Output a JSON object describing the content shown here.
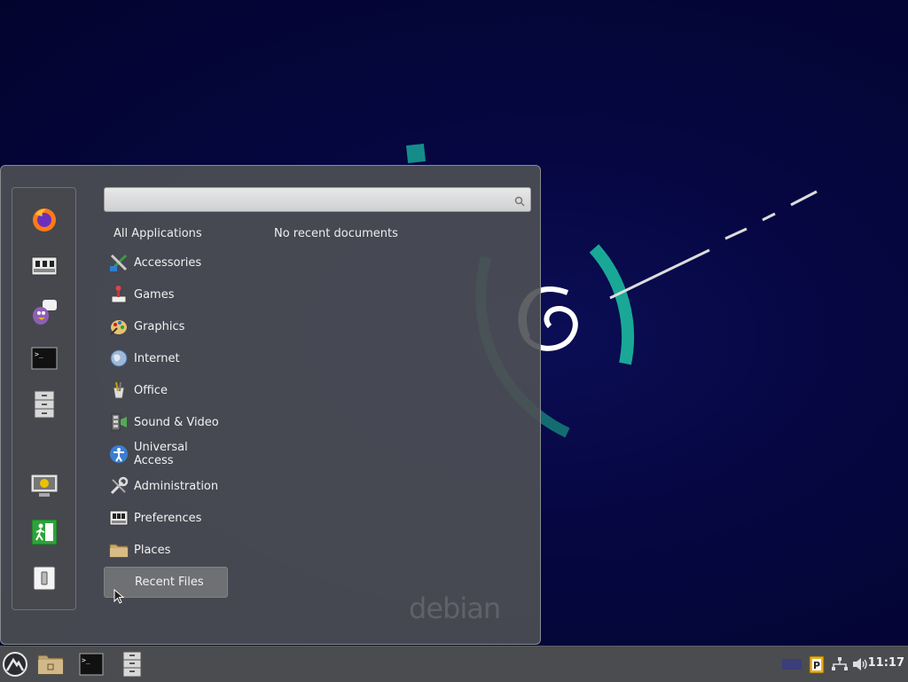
{
  "desktop": {
    "wordmark": "debian"
  },
  "menu": {
    "search": {
      "value": "",
      "placeholder": ""
    },
    "headers": {
      "all_applications": "All Applications",
      "no_recent": "No recent documents"
    },
    "categories": [
      {
        "label": "Accessories",
        "icon": "accessories-icon"
      },
      {
        "label": "Games",
        "icon": "games-icon"
      },
      {
        "label": "Graphics",
        "icon": "graphics-icon"
      },
      {
        "label": "Internet",
        "icon": "internet-icon"
      },
      {
        "label": "Office",
        "icon": "office-icon"
      },
      {
        "label": "Sound & Video",
        "icon": "sound-video-icon"
      },
      {
        "label": "Universal Access",
        "icon": "universal-access-icon"
      },
      {
        "label": "Administration",
        "icon": "administration-icon"
      },
      {
        "label": "Preferences",
        "icon": "preferences-icon"
      },
      {
        "label": "Places",
        "icon": "places-folder-icon"
      },
      {
        "label": "Recent Files",
        "icon": "",
        "selected": true
      }
    ],
    "favorites": [
      "firefox-icon",
      "settings-icon",
      "pidgin-icon",
      "terminal-icon",
      "file-manager-icon",
      "lock-screen-icon",
      "logout-icon",
      "shutdown-icon"
    ]
  },
  "taskbar": {
    "clock": "11:17",
    "launchers": [
      "menu-icon",
      "home-folder-icon",
      "terminal-icon",
      "file-manager-icon"
    ],
    "tray": [
      "keyboard-icon",
      "clipboard-icon",
      "network-icon",
      "volume-icon"
    ]
  },
  "colors": {
    "accent_teal": "#1aa594",
    "panel_bg": "#4e5054",
    "desktop_bg": "#050638"
  }
}
